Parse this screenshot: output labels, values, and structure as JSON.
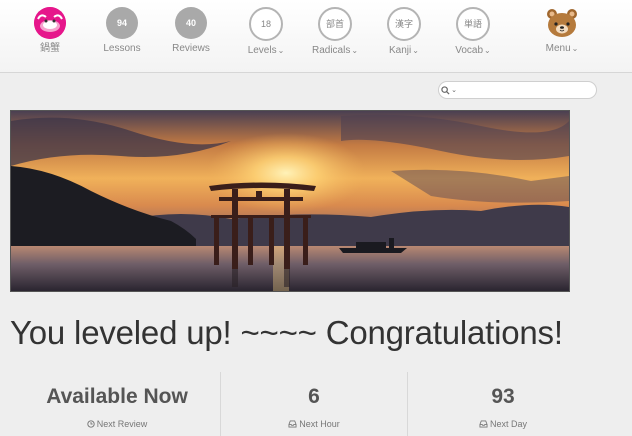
{
  "nav": {
    "user": {
      "name": "鍋蟹"
    },
    "lessons": {
      "count": "94",
      "label": "Lessons"
    },
    "reviews": {
      "count": "40",
      "label": "Reviews"
    },
    "levels": {
      "badge": "18",
      "label": "Levels"
    },
    "radicals": {
      "badge": "部首",
      "label": "Radicals"
    },
    "kanji": {
      "badge": "漢字",
      "label": "Kanji"
    },
    "vocab": {
      "badge": "単語",
      "label": "Vocab"
    },
    "menu": {
      "label": "Menu"
    }
  },
  "search": {
    "value": "",
    "placeholder": ""
  },
  "icons": {
    "avatar": "crab-avatar-icon",
    "menu": "bear-icon",
    "search": "search-icon",
    "next_review": "clock-icon",
    "next_hour": "inbox-icon",
    "next_day": "inbox-icon"
  },
  "hero": {
    "alt": ""
  },
  "headline": "You leveled up! ~~~~ Congratulations!",
  "stats": [
    {
      "value": "Available Now",
      "label": "Next Review"
    },
    {
      "value": "6",
      "label": "Next Hour"
    },
    {
      "value": "93",
      "label": "Next Day"
    }
  ],
  "colors": {
    "avatar_bg": "#e6168b",
    "badge_fill": "#a9a9a9",
    "badge_outline": "#b4b4b4",
    "page_bg": "#eeeeee"
  }
}
